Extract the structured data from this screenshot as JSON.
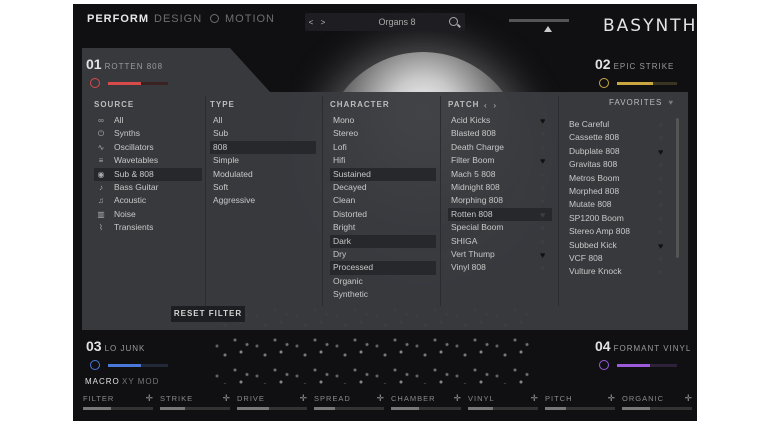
{
  "nav": {
    "tabs": [
      "PERFORM",
      "DESIGN",
      "MOTION"
    ],
    "preset_name": "Organs 8",
    "prev_label": "<",
    "next_label": ">",
    "logo": "BASYNTH"
  },
  "layers": [
    {
      "number": "01",
      "name": "ROTTEN 808",
      "power_color": "#d94a4a",
      "level": 0.55
    },
    {
      "number": "02",
      "name": "EPIC STRIKE",
      "power_color": "#c9a640",
      "level": 0.6
    },
    {
      "number": "03",
      "name": "LO JUNK",
      "power_color": "#4a78d9",
      "level": 0.55
    },
    {
      "number": "04",
      "name": "FORMANT VINYL",
      "power_color": "#9b5ad9",
      "level": 0.55
    }
  ],
  "browser": {
    "headers": {
      "source": "SOURCE",
      "type": "TYPE",
      "character": "CHARACTER",
      "patch": "PATCH",
      "favorites": "FAVORITES"
    },
    "source": [
      {
        "icon": "∞",
        "label": "All"
      },
      {
        "icon": "⏻",
        "label": "Synths"
      },
      {
        "icon": "∿",
        "label": "Oscillators"
      },
      {
        "icon": "≡",
        "label": "Wavetables"
      },
      {
        "icon": "◉",
        "label": "Sub & 808",
        "selected": true
      },
      {
        "icon": "♪",
        "label": "Bass Guitar"
      },
      {
        "icon": "♫",
        "label": "Acoustic"
      },
      {
        "icon": "▥",
        "label": "Noise"
      },
      {
        "icon": "⌇",
        "label": "Transients"
      }
    ],
    "type": [
      {
        "label": "All"
      },
      {
        "label": "Sub"
      },
      {
        "label": "808",
        "selected": true
      },
      {
        "label": "Simple"
      },
      {
        "label": "Modulated"
      },
      {
        "label": "Soft"
      },
      {
        "label": "Aggressive"
      }
    ],
    "character": [
      {
        "label": "Mono"
      },
      {
        "label": "Stereo"
      },
      {
        "label": "Lofi"
      },
      {
        "label": "Hifi"
      },
      {
        "label": "Sustained",
        "selected": true
      },
      {
        "label": "Decayed"
      },
      {
        "label": "Clean"
      },
      {
        "label": "Distorted"
      },
      {
        "label": "Bright"
      },
      {
        "label": "Dark",
        "selected": true
      },
      {
        "label": "Dry"
      },
      {
        "label": "Processed",
        "selected": true
      },
      {
        "label": "Organic"
      },
      {
        "label": "Synthetic"
      }
    ],
    "patches": [
      {
        "label": "Acid Kicks",
        "fav": true
      },
      {
        "label": "Blasted 808",
        "fav": false
      },
      {
        "label": "Death Charge",
        "fav": false
      },
      {
        "label": "Filter Boom",
        "fav": true
      },
      {
        "label": "Mach 5 808",
        "fav": false
      },
      {
        "label": "Midnight 808",
        "fav": false
      },
      {
        "label": "Morphing 808",
        "fav": false
      },
      {
        "label": "Rotten 808",
        "fav": false,
        "selected": true
      },
      {
        "label": "Special Boom",
        "fav": false
      },
      {
        "label": "SHIGA",
        "fav": false
      },
      {
        "label": "Vert Thump",
        "fav": true
      },
      {
        "label": "Vinyl 808",
        "fav": false
      }
    ],
    "patches_right": [
      {
        "label": "Be Careful",
        "fav": false
      },
      {
        "label": "Cassette 808",
        "fav": false
      },
      {
        "label": "Dubplate 808",
        "fav": true
      },
      {
        "label": "Gravitas 808",
        "fav": false
      },
      {
        "label": "Metros Boom",
        "fav": false
      },
      {
        "label": "Morphed 808",
        "fav": false
      },
      {
        "label": "Mutate 808",
        "fav": false
      },
      {
        "label": "SP1200 Boom",
        "fav": false
      },
      {
        "label": "Stereo Amp 808",
        "fav": false
      },
      {
        "label": "Subbed Kick",
        "fav": true
      },
      {
        "label": "VCF 808",
        "fav": false
      },
      {
        "label": "Vulture Knock",
        "fav": false
      }
    ],
    "reset_label": "RESET FILTER"
  },
  "bottom": {
    "tabs": [
      "MACRO",
      "XY MOD"
    ],
    "macros": [
      {
        "label": "FILTER",
        "value": 0.4
      },
      {
        "label": "STRIKE",
        "value": 0.35
      },
      {
        "label": "DRIVE",
        "value": 0.45
      },
      {
        "label": "SPREAD",
        "value": 0.3
      },
      {
        "label": "CHAMBER",
        "value": 0.4
      },
      {
        "label": "VINYL",
        "value": 0.35
      },
      {
        "label": "PITCH",
        "value": 0.3
      },
      {
        "label": "ORGANIC",
        "value": 0.4
      }
    ]
  }
}
